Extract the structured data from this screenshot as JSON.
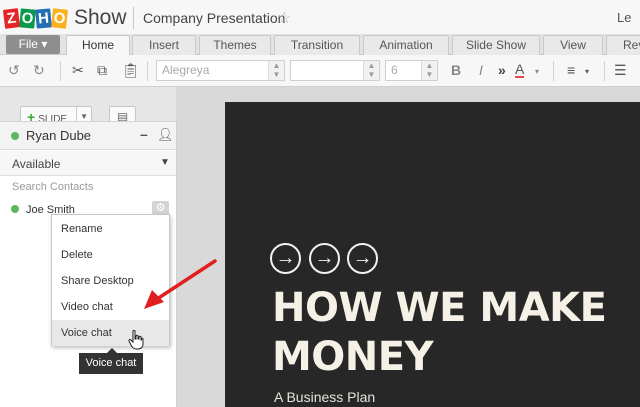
{
  "app": {
    "logo_letters": [
      "Z",
      "O",
      "H",
      "O"
    ],
    "name": "Show",
    "document_title": "Company Presentation",
    "user_initial": "Le"
  },
  "menu": {
    "file_label": "File",
    "tabs": [
      {
        "label": "Home"
      },
      {
        "label": "Insert"
      },
      {
        "label": "Themes"
      },
      {
        "label": "Transition"
      },
      {
        "label": "Animation"
      },
      {
        "label": "Slide Show"
      },
      {
        "label": "View"
      },
      {
        "label": "Rev"
      }
    ],
    "active_tab": "Home"
  },
  "toolbar": {
    "font_family": "Alegreya",
    "font_size_secondary": "",
    "font_size": "6",
    "bold": "B",
    "italic": "I",
    "superscript": "»",
    "color": "A",
    "accent_color": "#e04b4b"
  },
  "sidebar": {
    "new_slide_label": "SLIDE"
  },
  "chat": {
    "user_name": "Ryan Dube",
    "status": "Available",
    "search_placeholder": "Search Contacts",
    "contacts": [
      {
        "name": "Joe Smith",
        "online": true
      }
    ],
    "presence_color": "#5cb85c"
  },
  "context_menu": {
    "items": [
      {
        "label": "Rename"
      },
      {
        "label": "Delete"
      },
      {
        "label": "Share Desktop"
      },
      {
        "label": "Video chat"
      },
      {
        "label": "Voice chat"
      }
    ],
    "hovered": "Voice chat",
    "tooltip": "Voice chat"
  },
  "slide": {
    "title_line1": "HOW WE MAKE",
    "title_line2": "MONEY",
    "subtitle": "A Business Plan",
    "background": "#272727"
  }
}
